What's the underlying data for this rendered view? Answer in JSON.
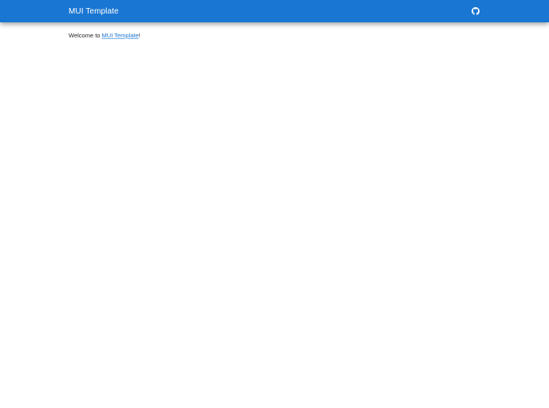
{
  "header": {
    "title": "MUI Template",
    "github_icon": "github-icon"
  },
  "main": {
    "welcome_prefix": "Welcome to ",
    "welcome_link": "MUI Template",
    "welcome_suffix": "!"
  },
  "colors": {
    "appbar": "#1976d2",
    "link": "#1976d2",
    "background": "#ffffff"
  }
}
